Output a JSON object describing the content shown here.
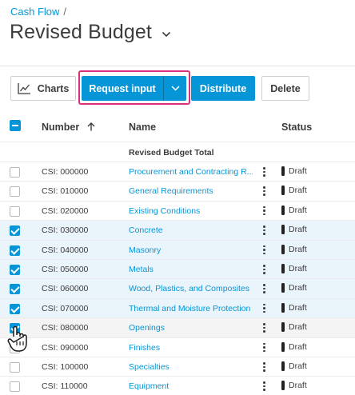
{
  "breadcrumb": {
    "parent": "Cash Flow",
    "separator": "/"
  },
  "page": {
    "title": "Revised Budget"
  },
  "toolbar": {
    "charts_label": "Charts",
    "request_input_label": "Request input",
    "distribute_label": "Distribute",
    "delete_label": "Delete"
  },
  "table": {
    "columns": {
      "number": "Number",
      "name": "Name",
      "status": "Status"
    },
    "total_label": "Revised Budget Total",
    "rows": [
      {
        "number": "CSI: 000000",
        "name": "Procurement and Contracting R...",
        "status": "Draft",
        "checked": false
      },
      {
        "number": "CSI: 010000",
        "name": "General Requirements",
        "status": "Draft",
        "checked": false
      },
      {
        "number": "CSI: 020000",
        "name": "Existing Conditions",
        "status": "Draft",
        "checked": false
      },
      {
        "number": "CSI: 030000",
        "name": "Concrete",
        "status": "Draft",
        "checked": true
      },
      {
        "number": "CSI: 040000",
        "name": "Masonry",
        "status": "Draft",
        "checked": true
      },
      {
        "number": "CSI: 050000",
        "name": "Metals",
        "status": "Draft",
        "checked": true
      },
      {
        "number": "CSI: 060000",
        "name": "Wood, Plastics, and Composites",
        "status": "Draft",
        "checked": true
      },
      {
        "number": "CSI: 070000",
        "name": "Thermal and Moisture Protection",
        "status": "Draft",
        "checked": true
      },
      {
        "number": "CSI: 080000",
        "name": "Openings",
        "status": "Draft",
        "checked": true
      },
      {
        "number": "CSI: 090000",
        "name": "Finishes",
        "status": "Draft",
        "checked": false
      },
      {
        "number": "CSI: 100000",
        "name": "Specialties",
        "status": "Draft",
        "checked": false
      },
      {
        "number": "CSI: 110000",
        "name": "Equipment",
        "status": "Draft",
        "checked": false
      }
    ]
  },
  "colors": {
    "accent": "#0696d7",
    "highlight_border": "#d9317c",
    "selected_row": "#eaf4fb"
  }
}
